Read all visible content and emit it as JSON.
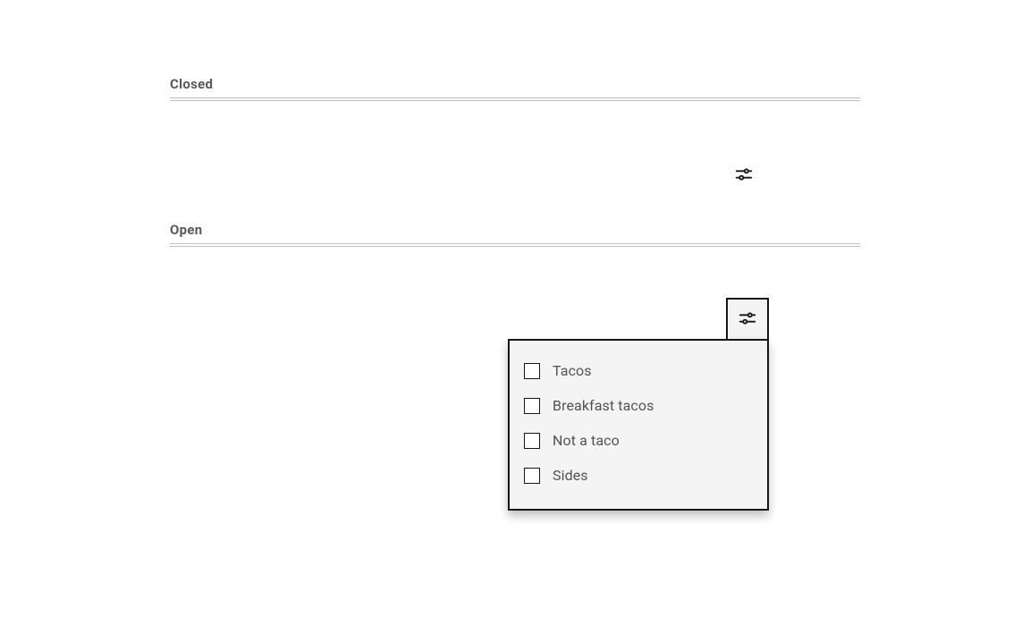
{
  "sections": {
    "closed_label": "Closed",
    "open_label": "Open"
  },
  "icons": {
    "filter": "filter-sliders-icon"
  },
  "filter_popover": {
    "options": [
      {
        "label": "Tacos",
        "checked": false
      },
      {
        "label": "Breakfast tacos",
        "checked": false
      },
      {
        "label": "Not a taco",
        "checked": false
      },
      {
        "label": "Sides",
        "checked": false
      }
    ]
  }
}
